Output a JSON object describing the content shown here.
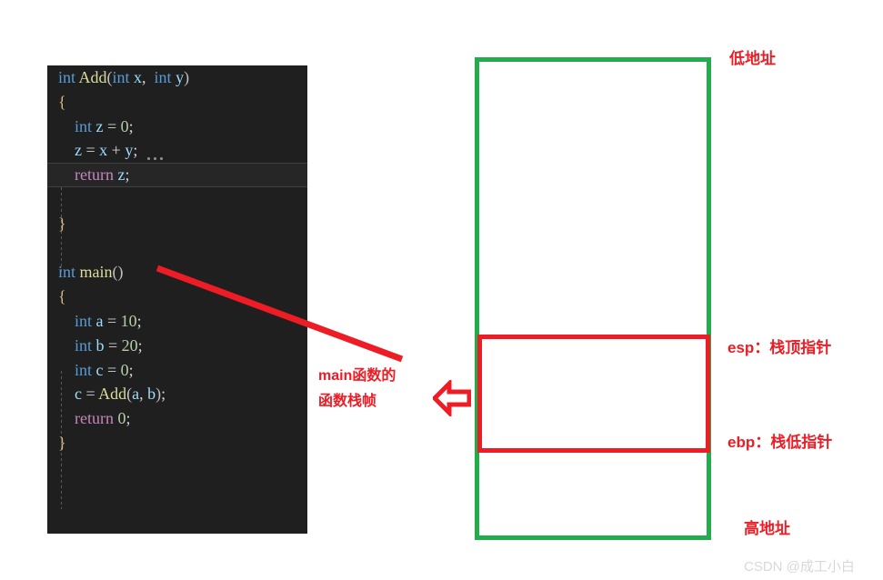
{
  "code_panel": {
    "language": "c",
    "background": "#1f1f1f",
    "lines": [
      {
        "id": "l1",
        "text": "int Add(int x, int y)",
        "current": false
      },
      {
        "id": "l2",
        "text": "{",
        "current": false
      },
      {
        "id": "l3",
        "text": "    int z = 0;",
        "current": false
      },
      {
        "id": "l4",
        "text": "    z = x + y;",
        "current": false
      },
      {
        "id": "l5",
        "text": "    return z;",
        "current": true
      },
      {
        "id": "l6",
        "text": "",
        "current": false
      },
      {
        "id": "l7",
        "text": "}",
        "current": false
      },
      {
        "id": "l8",
        "text": "",
        "current": false
      },
      {
        "id": "l9",
        "text": "int main()",
        "current": false
      },
      {
        "id": "l10",
        "text": "{",
        "current": false
      },
      {
        "id": "l11",
        "text": "    int a = 10;",
        "current": false
      },
      {
        "id": "l12",
        "text": "    int b = 20;",
        "current": false
      },
      {
        "id": "l13",
        "text": "    int c = 0;",
        "current": false
      },
      {
        "id": "l14",
        "text": "    c = Add(a, b);",
        "current": false
      },
      {
        "id": "l15",
        "text": "    return 0;",
        "current": false
      },
      {
        "id": "l16",
        "text": "}",
        "current": false
      }
    ]
  },
  "diagram": {
    "stack_outer_label": "memory-stack-region",
    "stack_frame_label": "main-function-stack-frame",
    "colors": {
      "stack_outline": "#22ac4b",
      "frame_outline": "#ee1c25",
      "annotation": "#ee1c25"
    },
    "labels": {
      "low_address": "低地址",
      "high_address": "高地址",
      "esp": "esp：栈顶指针",
      "ebp": "ebp：栈低指针",
      "main_frame_line1": "main函数的",
      "main_frame_line2": "函数栈帧"
    }
  },
  "watermark": {
    "text": "CSDN @成工小白"
  }
}
